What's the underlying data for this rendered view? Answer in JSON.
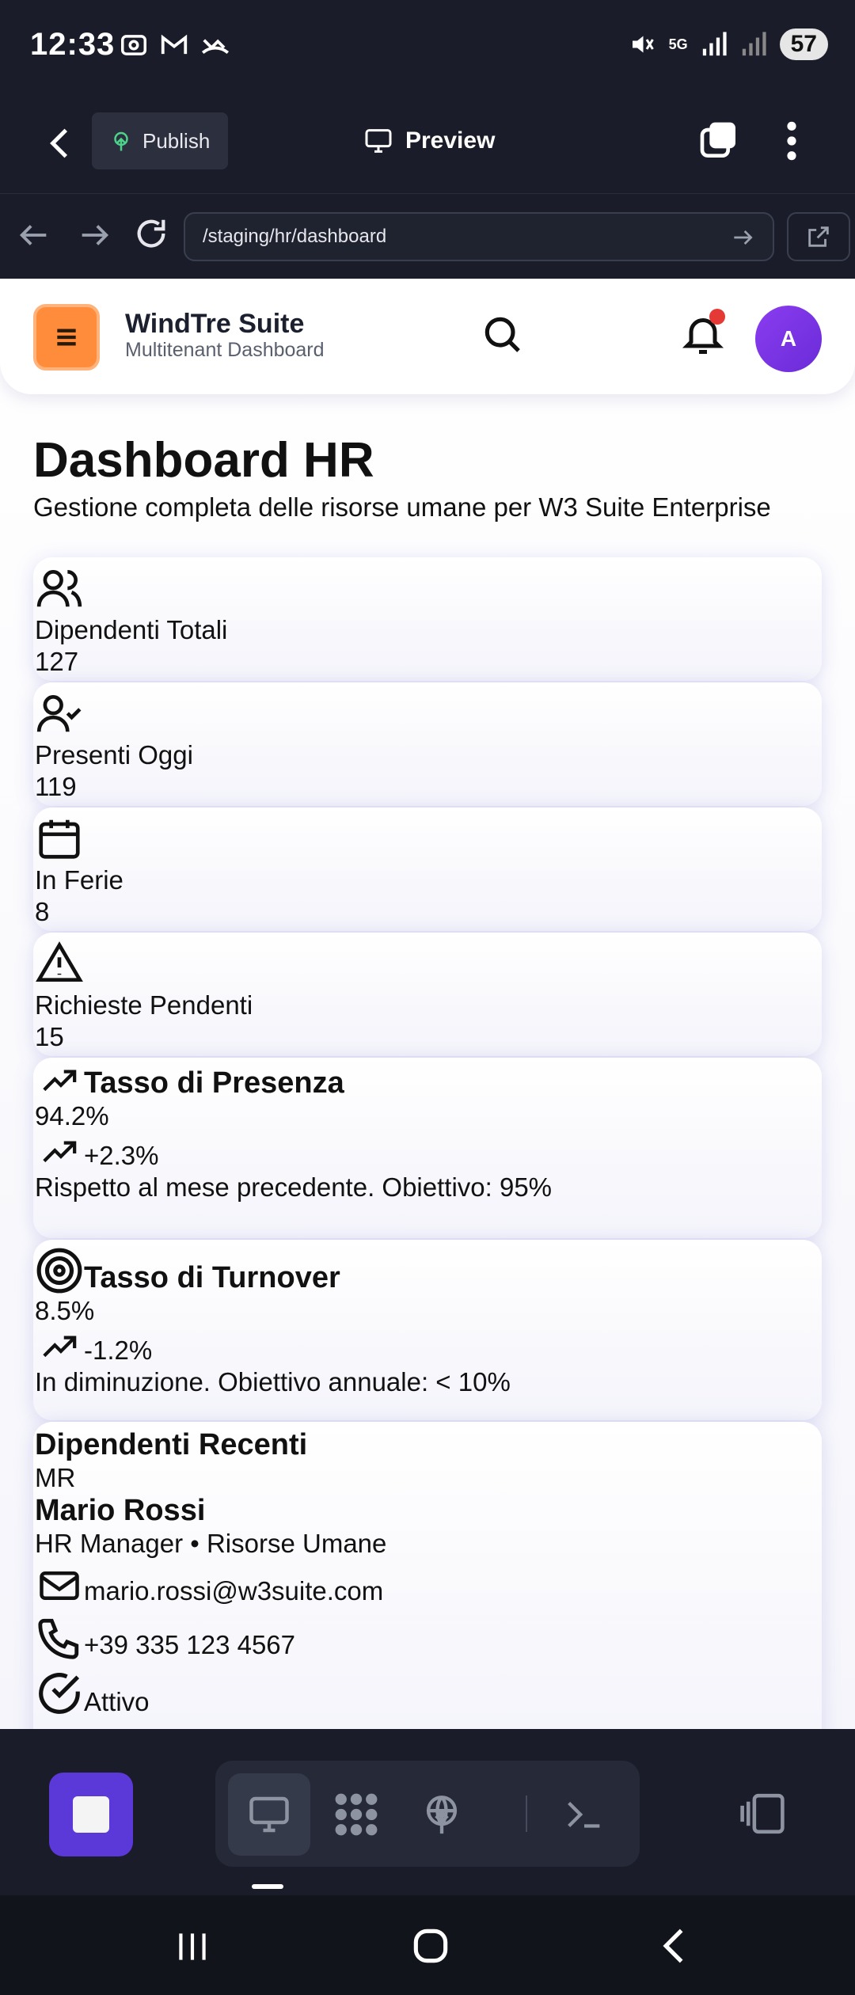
{
  "status_bar": {
    "time": "12:33",
    "network": "5G",
    "battery": "57"
  },
  "app_toolbar": {
    "publish_label": "Publish",
    "preview_label": "Preview"
  },
  "url_bar": {
    "url": "/staging/hr/dashboard"
  },
  "site_header": {
    "brand_title": "WindTre Suite",
    "brand_subtitle": "Multitenant Dashboard",
    "avatar_initial": "A",
    "colors": {
      "hamburger": "#ff8c3a",
      "avatar": "#7a33e6",
      "notification_dot": "#e53935"
    }
  },
  "page": {
    "title": "Dashboard HR",
    "subtitle": "Gestione completa delle risorse umane per W3 Suite Enterprise"
  },
  "stats": [
    {
      "icon": "users-icon",
      "label": "Dipendenti Totali",
      "value": "127"
    },
    {
      "icon": "user-check-icon",
      "label": "Presenti Oggi",
      "value": "119"
    },
    {
      "icon": "calendar-icon",
      "label": "In Ferie",
      "value": "8"
    },
    {
      "icon": "alert-triangle-icon",
      "label": "Richieste Pendenti",
      "value": "15"
    }
  ],
  "kpis": [
    {
      "icon": "trending-up-icon",
      "title": "Tasso di Presenza",
      "value": "94.2%",
      "delta": "+2.3%",
      "note": "Rispetto al mese precedente. Obiettivo: 95%"
    },
    {
      "icon": "target-icon",
      "title": "Tasso di Turnover",
      "value": "8.5%",
      "delta": "-1.2%",
      "note": "In diminuzione. Obiettivo annuale: < 10%"
    }
  ],
  "recent": {
    "title": "Dipendenti Recenti",
    "employee": {
      "initials": "MR",
      "name": "Mario Rossi",
      "role": "HR Manager • Risorse Umane",
      "email": "mario.rossi@w3suite.com",
      "phone": "+39 335 123 4567",
      "status": "Attivo"
    }
  },
  "dock": {
    "accent": "#5b38d8"
  }
}
